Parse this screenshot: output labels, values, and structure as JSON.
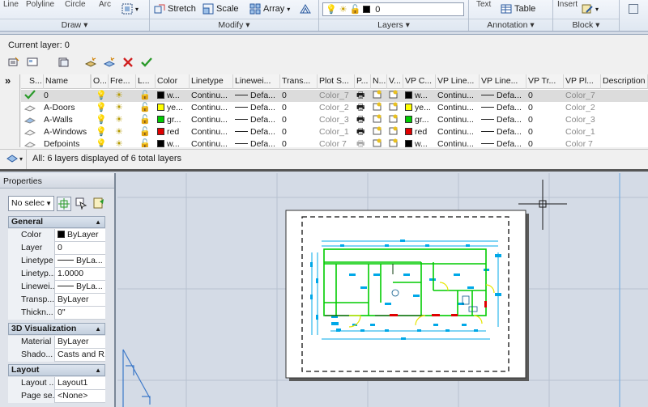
{
  "ribbon": {
    "top_captions": [
      "Line",
      "Polyline",
      "Circle",
      "Arc",
      "Text",
      "Insert"
    ],
    "modify_items": [
      "Stretch",
      "Scale",
      "Array"
    ],
    "layer_combo_value": "0",
    "table_label": "Table",
    "panels": [
      "Draw",
      "Layers",
      "Modify",
      "Annotation",
      "Block"
    ]
  },
  "layer_manager": {
    "current_layer_label": "Current layer: 0",
    "columns": [
      "S...",
      "Name",
      "O...",
      "Fre...",
      "L...",
      "Color",
      "Linetype",
      "Linewei...",
      "Trans...",
      "Plot S...",
      "P...",
      "N...",
      "V...",
      "VP C...",
      "VP Line...",
      "VP Line...",
      "VP Tr...",
      "VP Pl...",
      "Description"
    ],
    "rows": [
      {
        "name": "0",
        "color_name": "w...",
        "color_hex": "#000000",
        "linetype": "Continu...",
        "lineweight": "Defa...",
        "transparency": "0",
        "plot_style": "Color_7",
        "vp_color": "w...",
        "vp_linetype": "Continu...",
        "vp_lineweight": "Defa...",
        "vp_trans": "0",
        "vp_plot": "Color_7"
      },
      {
        "name": "A-Doors",
        "color_name": "ye...",
        "color_hex": "#ffff00",
        "linetype": "Continu...",
        "lineweight": "Defa...",
        "transparency": "0",
        "plot_style": "Color_2",
        "vp_color": "ye...",
        "vp_linetype": "Continu...",
        "vp_lineweight": "Defa...",
        "vp_trans": "0",
        "vp_plot": "Color_2"
      },
      {
        "name": "A-Walls",
        "color_name": "gr...",
        "color_hex": "#00cc00",
        "linetype": "Continu...",
        "lineweight": "Defa...",
        "transparency": "0",
        "plot_style": "Color_3",
        "vp_color": "gr...",
        "vp_linetype": "Continu...",
        "vp_lineweight": "Defa...",
        "vp_trans": "0",
        "vp_plot": "Color_3"
      },
      {
        "name": "A-Windows",
        "color_name": "red",
        "color_hex": "#e00000",
        "linetype": "Continu...",
        "lineweight": "Defa...",
        "transparency": "0",
        "plot_style": "Color_1",
        "vp_color": "red",
        "vp_linetype": "Continu...",
        "vp_lineweight": "Defa...",
        "vp_trans": "0",
        "vp_plot": "Color_1"
      },
      {
        "name": "Defpoints",
        "color_name": "w...",
        "color_hex": "#000000",
        "linetype": "Continu...",
        "lineweight": "Defa...",
        "transparency": "0",
        "plot_style": "Color 7",
        "vp_color": "w...",
        "vp_linetype": "Continu...",
        "vp_lineweight": "Defa...",
        "vp_trans": "0",
        "vp_plot": "Color 7"
      }
    ],
    "status_text": "All: 6 layers displayed of 6 total layers"
  },
  "properties": {
    "title": "Properties",
    "selection_value": "No selec",
    "sections": {
      "general": "General",
      "viz3d": "3D Visualization",
      "layout": "Layout"
    },
    "general_rows": [
      {
        "key": "Color",
        "value": "ByLayer"
      },
      {
        "key": "Layer",
        "value": "0"
      },
      {
        "key": "Linetype",
        "value": "ByLa..."
      },
      {
        "key": "Linetyp...",
        "value": "1.0000"
      },
      {
        "key": "Linewei...",
        "value": "ByLa..."
      },
      {
        "key": "Transp...",
        "value": "ByLayer"
      },
      {
        "key": "Thickn...",
        "value": "0\""
      }
    ],
    "viz3d_rows": [
      {
        "key": "Material",
        "value": "ByLayer"
      },
      {
        "key": "Shado...",
        "value": "Casts and R..."
      }
    ],
    "layout_rows": [
      {
        "key": "Layout ...",
        "value": "Layout1"
      },
      {
        "key": "Page se...",
        "value": "<None>"
      }
    ]
  },
  "colors": {
    "accent": "#3c78c8",
    "wall": "#00cc00",
    "dimension": "#00a8e8",
    "door": "#ffff00",
    "window": "#e00000"
  }
}
